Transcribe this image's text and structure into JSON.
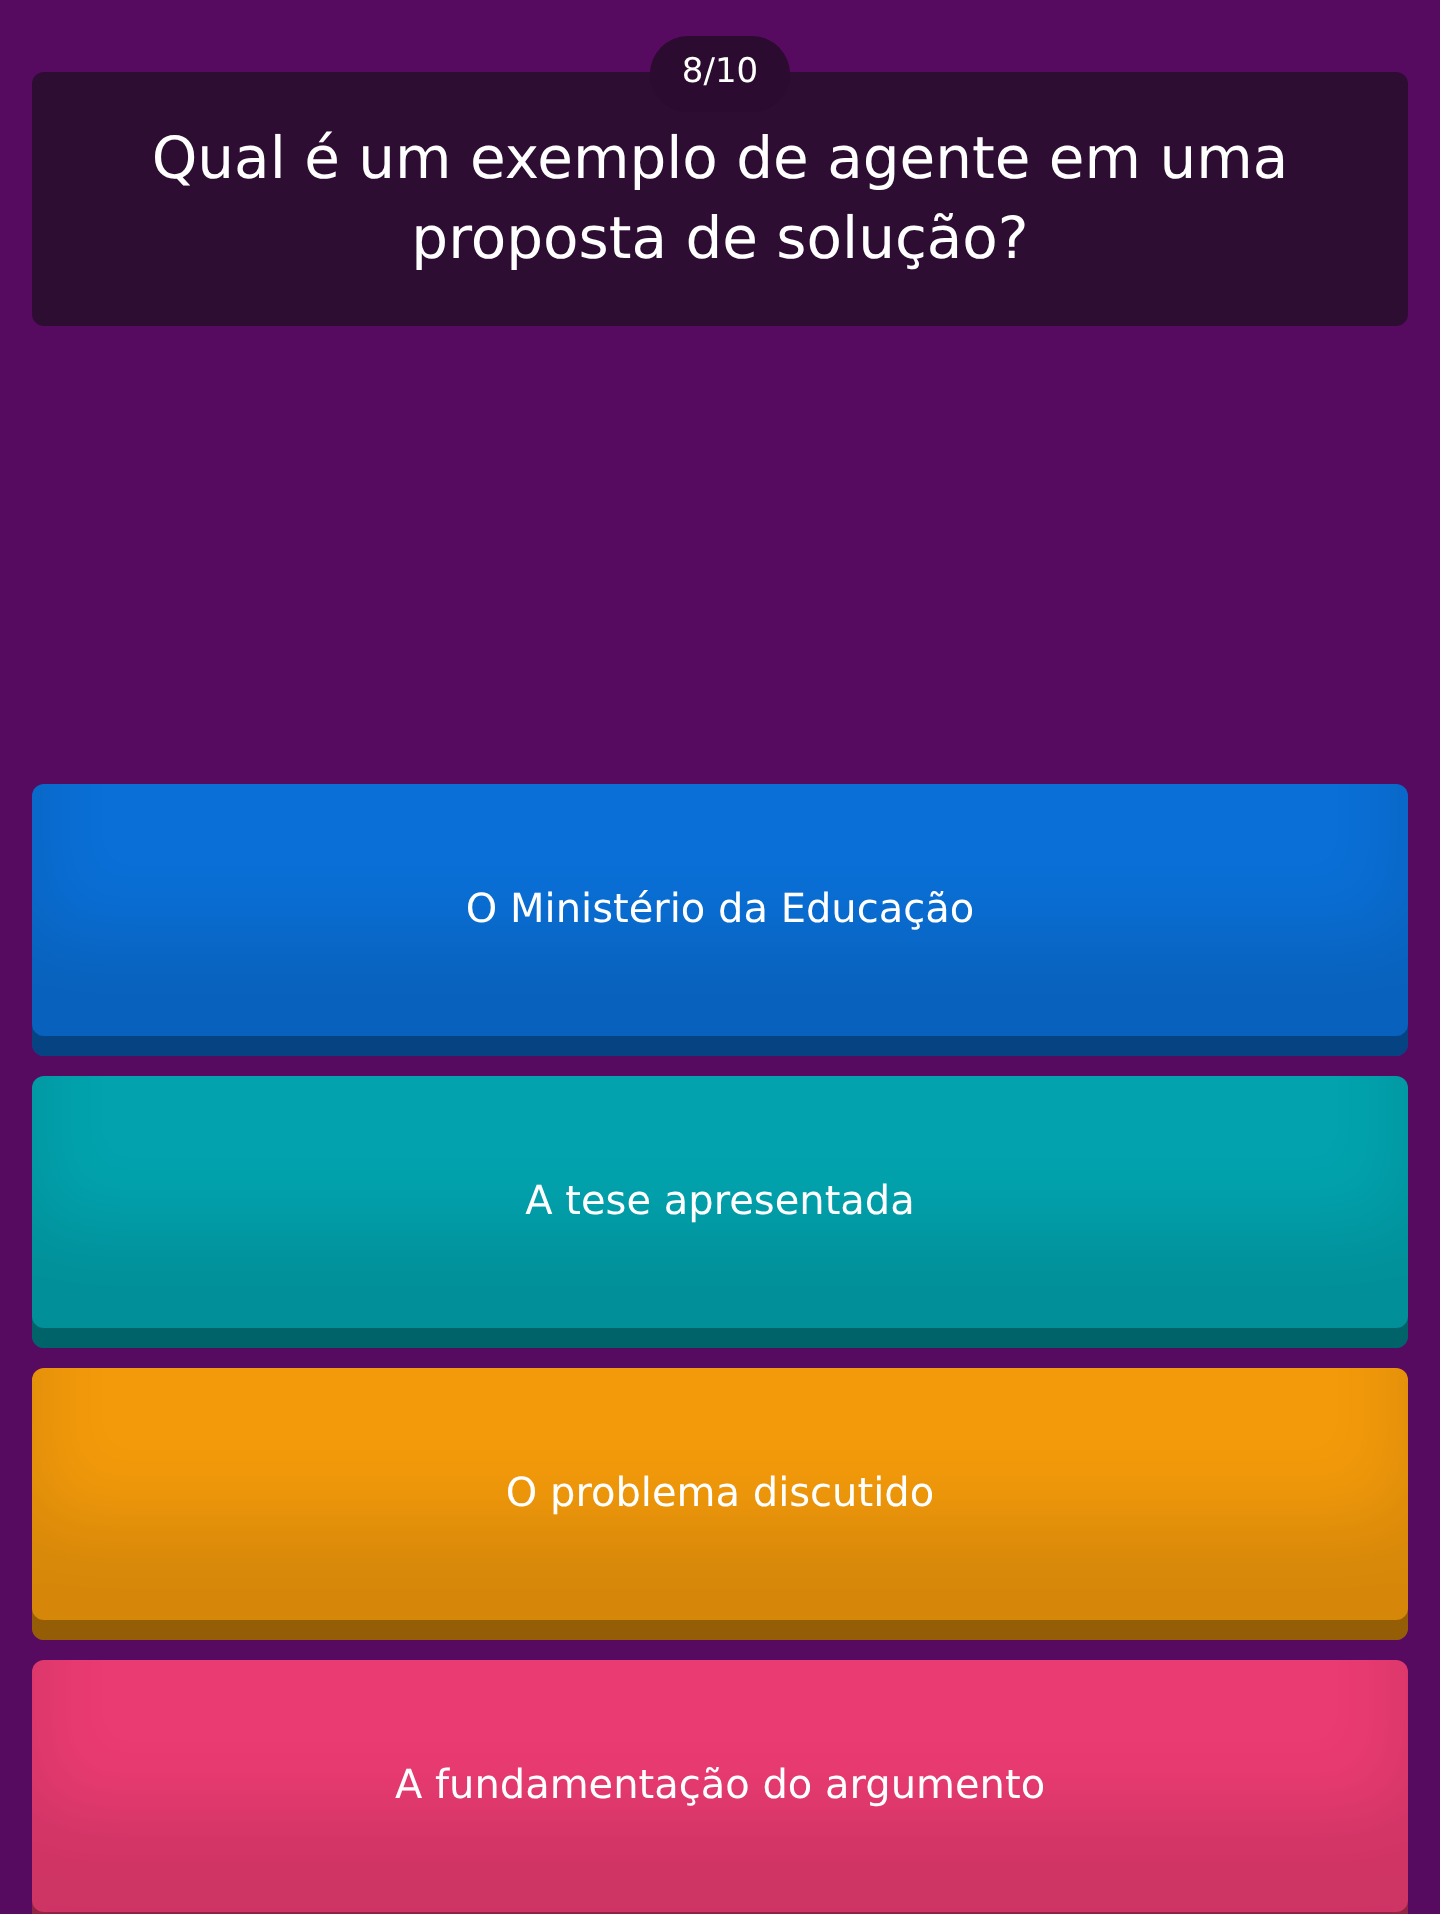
{
  "counter": "8/10",
  "question": "Qual é um exemplo de agente em uma proposta de solução?",
  "answers": [
    {
      "label": "O Ministério da Educação",
      "color": "#0a6fd6"
    },
    {
      "label": "A tese apresentada",
      "color": "#02a3ae"
    },
    {
      "label": "O problema discutido",
      "color": "#f39a0b"
    },
    {
      "label": "A fundamentação do argumento",
      "color": "#ea3b72"
    }
  ]
}
